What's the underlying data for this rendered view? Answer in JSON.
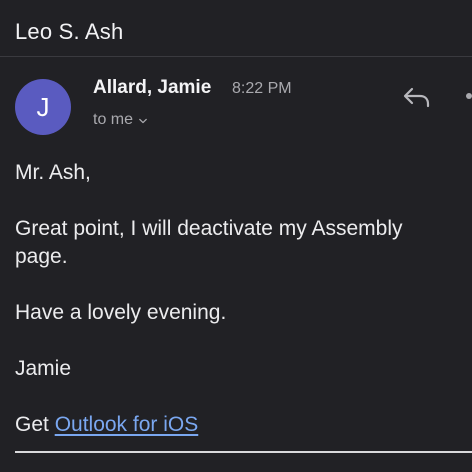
{
  "header": {
    "subject": "Leo S. Ash"
  },
  "message": {
    "avatar_initial": "J",
    "avatar_color": "#5a5bc0",
    "sender_name": "Allard, Jamie",
    "time": "8:22 PM",
    "recipient_label": "to me"
  },
  "icons": {
    "reply": "reply-arrow-icon",
    "more": "more-options-icon",
    "chevron": "chevron-down-icon"
  },
  "body": {
    "greeting": "Mr. Ash,",
    "paragraph_1": "Great point, I will deactivate my Assembly page.",
    "paragraph_2": "Have a lovely evening.",
    "signoff": "Jamie",
    "signature_prefix": "Get ",
    "signature_link": "Outlook for iOS"
  },
  "colors": {
    "background": "#212125",
    "link": "#7aa7f0"
  }
}
